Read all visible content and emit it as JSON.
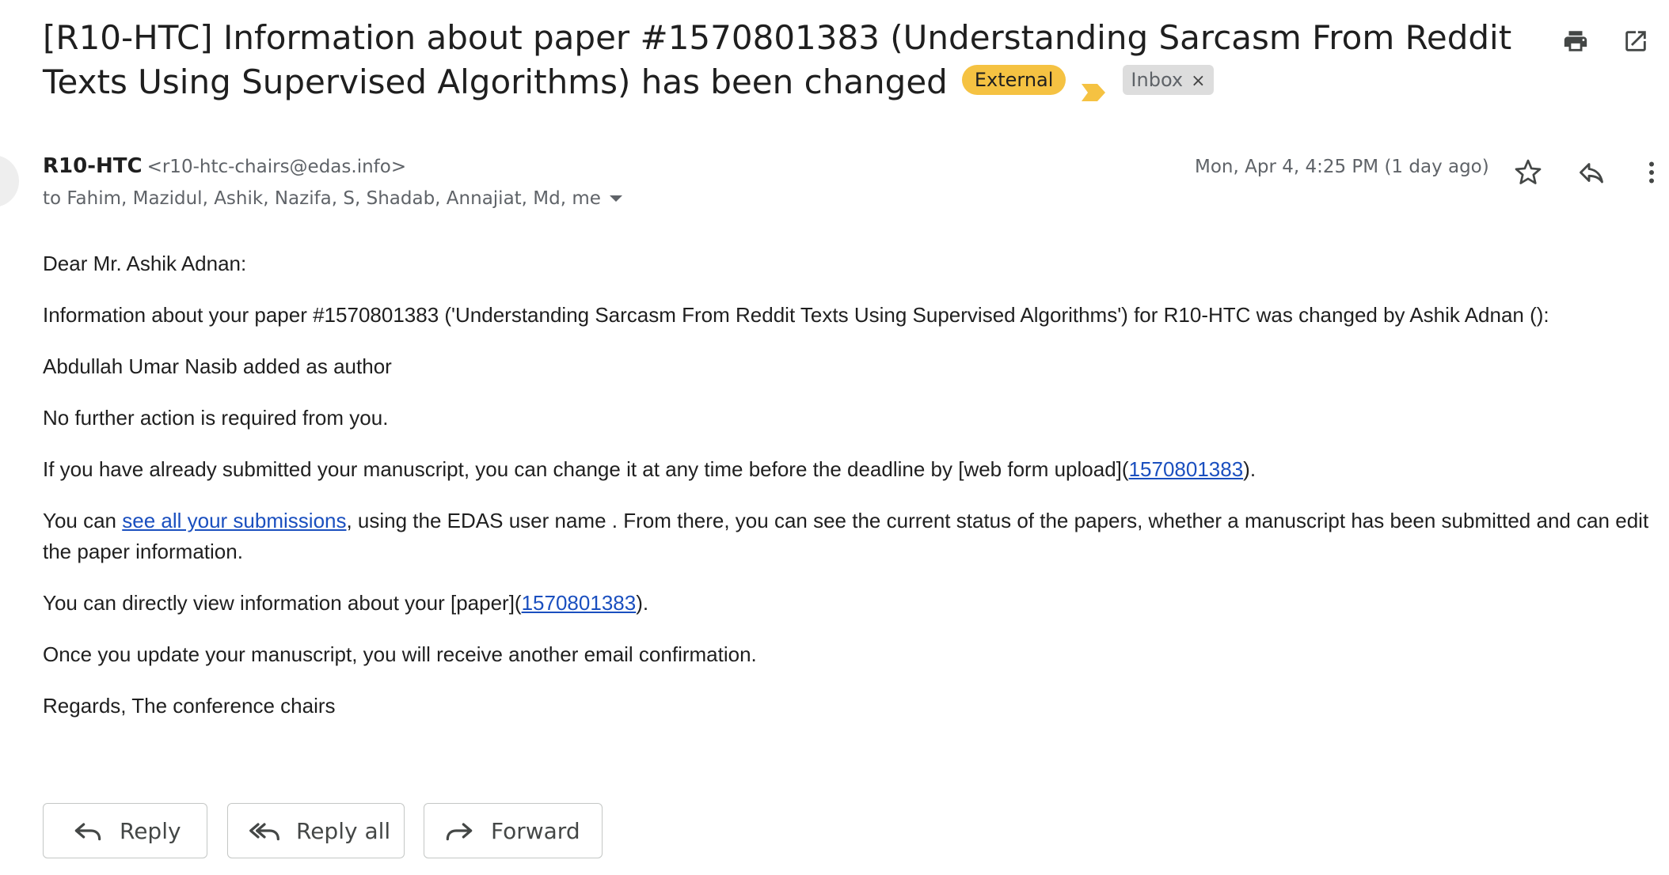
{
  "email": {
    "subject": "[R10-HTC] Information about paper #1570801383 (Understanding Sarcasm From Reddit Texts Using Supervised Algorithms) has been changed",
    "labels": {
      "external": "External",
      "inbox": "Inbox",
      "inbox_remove": "×"
    },
    "sender": {
      "name": "R10-HTC",
      "email": "<r10-htc-chairs@edas.info>"
    },
    "recipients": "to Fahim, Mazidul, Ashik, Nazifa, S, Shadab, Annajiat, Md, me",
    "date": "Mon, Apr 4, 4:25 PM (1 day ago)",
    "body": {
      "greeting": "Dear Mr. Ashik Adnan:",
      "p1": "Information about your paper #1570801383 ('Understanding Sarcasm From Reddit Texts Using Supervised Algorithms') for R10-HTC was changed by Ashik Adnan ():",
      "p2": "Abdullah Umar Nasib added as author",
      "p3": "No further action is required from you.",
      "p4_before": "If you have already submitted your manuscript, you can change it at any time before the deadline by [web form upload](",
      "p4_link": "1570801383",
      "p4_after": ").",
      "p5_before": "You can ",
      "p5_link": "see all your submissions",
      "p5_after": ", using the EDAS user name . From there, you can see the current status of the papers, whether a manuscript has been submitted and can edit the paper information.",
      "p6_before": "You can directly view information about your [paper](",
      "p6_link": "1570801383",
      "p6_after": ").",
      "p7": "Once you update your manuscript, you will receive another email confirmation.",
      "p8": "Regards, The conference chairs"
    },
    "actions": {
      "reply": "Reply",
      "reply_all": "Reply all",
      "forward": "Forward"
    }
  },
  "icons": {
    "print": "print-icon",
    "open_new_window": "open-in-new-window-icon",
    "star": "star-icon",
    "reply": "reply-icon",
    "more": "more-vert-icon",
    "dropdown": "caret-down-icon",
    "importance": "importance-marker-icon"
  },
  "colors": {
    "external_chip": "#f5c242",
    "importance_marker": "#f5c242",
    "inbox_chip": "#dddddd",
    "link": "#1a4fbf"
  }
}
